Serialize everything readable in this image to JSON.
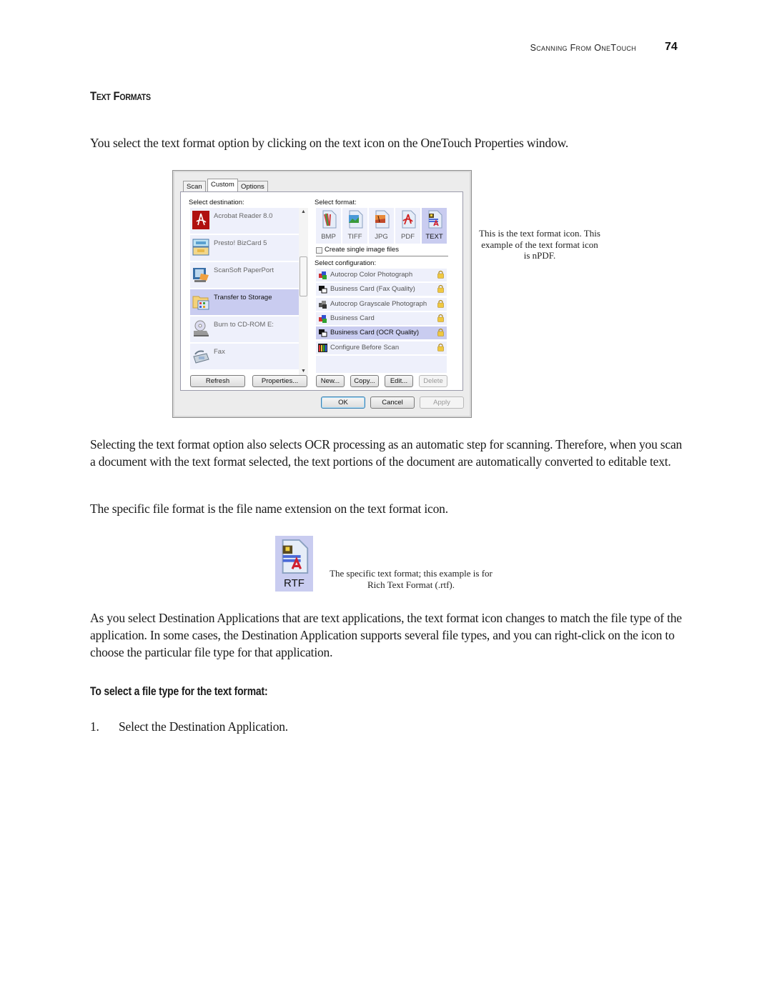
{
  "header": {
    "running_title": "Scanning From OneTouch",
    "page_number": "74"
  },
  "section_title": "Text Formats",
  "intro_paragraph": "You select the text format option by clicking on the text icon on the OneTouch Properties window.",
  "dialog": {
    "tabs": [
      {
        "label": "Scan",
        "active": false
      },
      {
        "label": "Custom",
        "active": true
      },
      {
        "label": "Options",
        "active": false
      }
    ],
    "select_destination_label": "Select destination:",
    "destinations": [
      {
        "label": "Acrobat Reader 8.0",
        "icon": "acrobat-reader-icon",
        "selected": false
      },
      {
        "label": "Presto! BizCard 5",
        "icon": "bizcard-icon",
        "selected": false
      },
      {
        "label": "ScanSoft PaperPort",
        "icon": "paperport-icon",
        "selected": false
      },
      {
        "label": "Transfer to Storage",
        "icon": "storage-folder-icon",
        "selected": true
      },
      {
        "label": "Burn to CD-ROM  E:",
        "icon": "cd-rom-icon",
        "selected": false
      },
      {
        "label": "Fax",
        "icon": "fax-icon",
        "selected": false
      }
    ],
    "select_format_label": "Select format:",
    "formats": [
      {
        "label": "BMP",
        "icon": "bmp-file-icon",
        "selected": false
      },
      {
        "label": "TIFF",
        "icon": "tiff-file-icon",
        "selected": false
      },
      {
        "label": "JPG",
        "icon": "jpg-file-icon",
        "selected": false
      },
      {
        "label": "PDF",
        "icon": "pdf-file-icon",
        "selected": false
      },
      {
        "label": "TEXT",
        "icon": "text-file-icon",
        "selected": true
      }
    ],
    "single_image_checkbox": {
      "label": "Create single image files",
      "checked": false
    },
    "select_configuration_label": "Select configuration:",
    "configurations": [
      {
        "label": "Autocrop Color Photograph",
        "icon": "color-cubes-icon",
        "selected": false
      },
      {
        "label": "Business Card (Fax Quality)",
        "icon": "bw-cards-icon",
        "selected": false
      },
      {
        "label": "Autocrop Grayscale Photograph",
        "icon": "gray-cubes-icon",
        "selected": false
      },
      {
        "label": "Business Card",
        "icon": "color-cubes-icon",
        "selected": false
      },
      {
        "label": "Business Card (OCR Quality)",
        "icon": "bw-cards-icon",
        "selected": true
      },
      {
        "label": "Configure Before Scan",
        "icon": "color-bars-icon",
        "selected": false
      }
    ],
    "buttons": {
      "refresh": "Refresh",
      "properties": "Properties...",
      "new": "New...",
      "copy": "Copy...",
      "edit": "Edit...",
      "delete": "Delete",
      "ok": "OK",
      "cancel": "Cancel",
      "apply": "Apply"
    }
  },
  "text_icon_callout": "This is the text format icon. This example of the text format icon is nPDF.",
  "paragraph_ocr": "Selecting the text format option also selects OCR processing as an automatic step for scanning. Therefore, when you scan a document with the text format selected, the text portions of the document are automatically converted to editable text.",
  "paragraph_extension": "The specific file format is the file name extension on the text format icon.",
  "rtf_icon": {
    "label": "RTF",
    "caption": "The specific text format; this example is for Rich Text Format (.rtf)."
  },
  "paragraph_destinations": "As you select Destination Applications that are text applications, the text format icon changes to match the file type of the application. In some cases, the Destination Application supports several file types, and you can right-click on the icon to choose the particular file type for that application.",
  "procedure_heading": "To select a file type for the text format:",
  "steps": [
    {
      "number": "1.",
      "text": "Select the Destination Application."
    }
  ]
}
